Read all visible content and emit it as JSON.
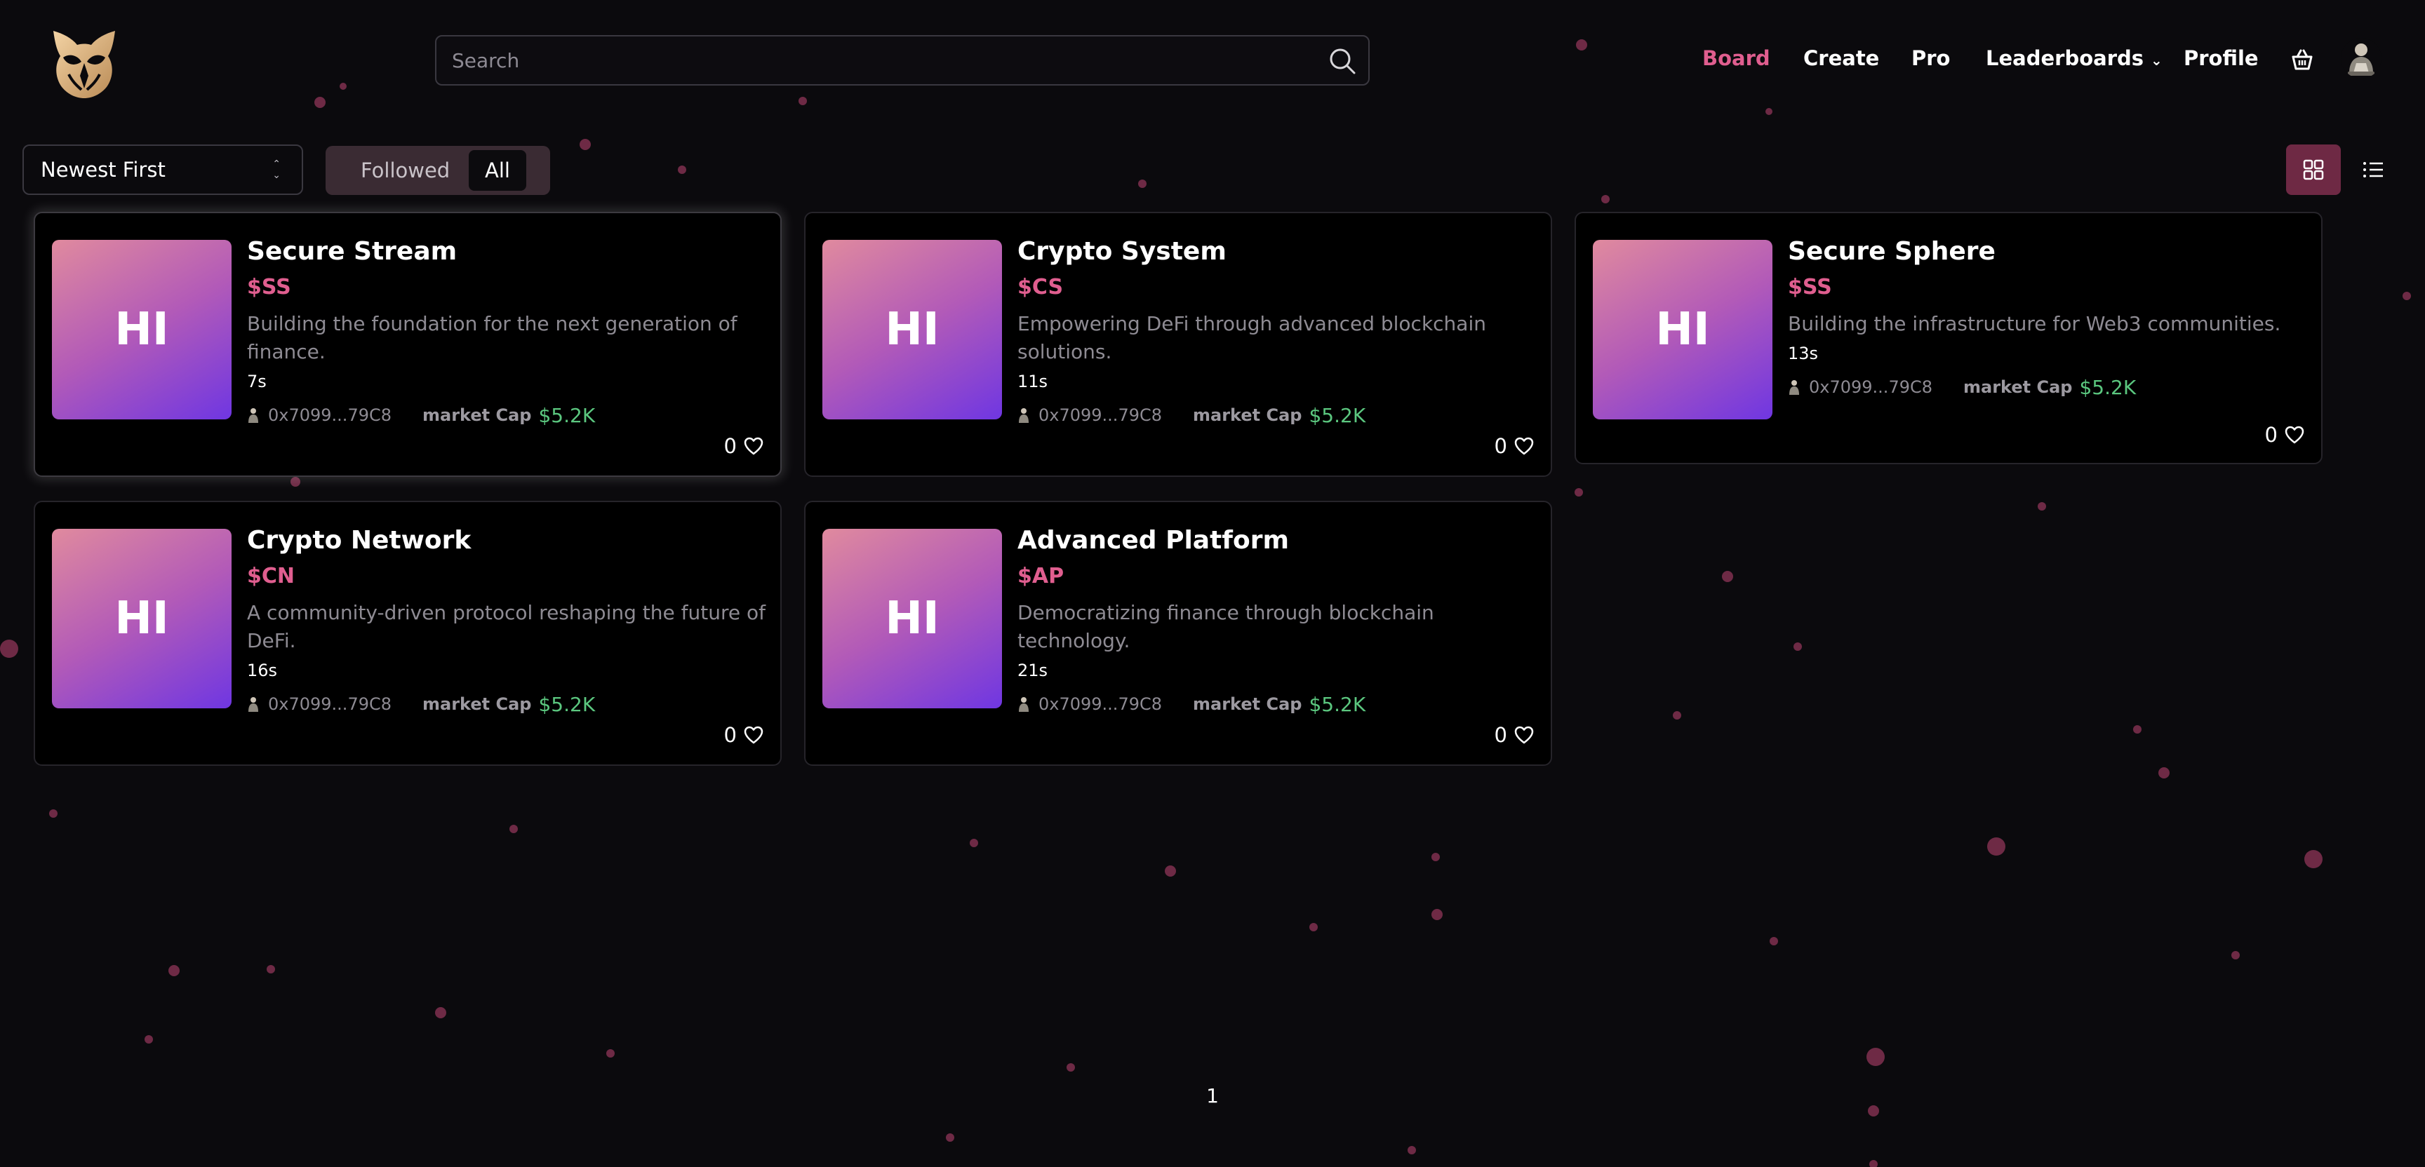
{
  "header": {
    "search_placeholder": "Search",
    "nav": {
      "board": "Board",
      "create": "Create",
      "pro": "Pro",
      "leaderboards": "Leaderboards",
      "profile": "Profile"
    }
  },
  "toolbar": {
    "sort_value": "Newest First",
    "filter_followed": "Followed",
    "filter_all": "All",
    "active_filter": "All",
    "active_view": "grid"
  },
  "cards": [
    {
      "thumb": "HI",
      "title": "Secure Stream",
      "ticker": "$SS",
      "description": "Building the foundation for the next generation of finance.",
      "age": "7s",
      "creator": "0x7099...79C8",
      "market_cap_label": "market Cap",
      "market_cap": "$5.2K",
      "likes": "0"
    },
    {
      "thumb": "HI",
      "title": "Crypto System",
      "ticker": "$CS",
      "description": "Empowering DeFi through advanced blockchain solutions.",
      "age": "11s",
      "creator": "0x7099...79C8",
      "market_cap_label": "market Cap",
      "market_cap": "$5.2K",
      "likes": "0"
    },
    {
      "thumb": "HI",
      "title": "Secure Sphere",
      "ticker": "$SS",
      "description": "Building the infrastructure for Web3 communities.",
      "age": "13s",
      "creator": "0x7099...79C8",
      "market_cap_label": "market Cap",
      "market_cap": "$5.2K",
      "likes": "0"
    },
    {
      "thumb": "HI",
      "title": "Crypto Network",
      "ticker": "$CN",
      "description": "A community-driven protocol reshaping the future of DeFi.",
      "age": "16s",
      "creator": "0x7099...79C8",
      "market_cap_label": "market Cap",
      "market_cap": "$5.2K",
      "likes": "0"
    },
    {
      "thumb": "HI",
      "title": "Advanced Platform",
      "ticker": "$AP",
      "description": "Democratizing finance through blockchain technology.",
      "age": "21s",
      "creator": "0x7099...79C8",
      "market_cap_label": "market Cap",
      "market_cap": "$5.2K",
      "likes": "0"
    }
  ],
  "pagination": {
    "current_page": "1"
  },
  "icons": {
    "logo": "owl-logo-icon",
    "search": "search-icon",
    "cart": "basket-icon",
    "grid_view": "grid-view-icon",
    "list_view": "list-view-icon",
    "like": "heart-icon",
    "creator": "creator-avatar-icon",
    "sort": "chevron-up-down-icon"
  },
  "colors": {
    "accent": "#e05e8f",
    "market_cap": "#5bc77f",
    "background": "#0b0a0d",
    "card_background": "#000000",
    "active_view_button": "#6e2944"
  }
}
